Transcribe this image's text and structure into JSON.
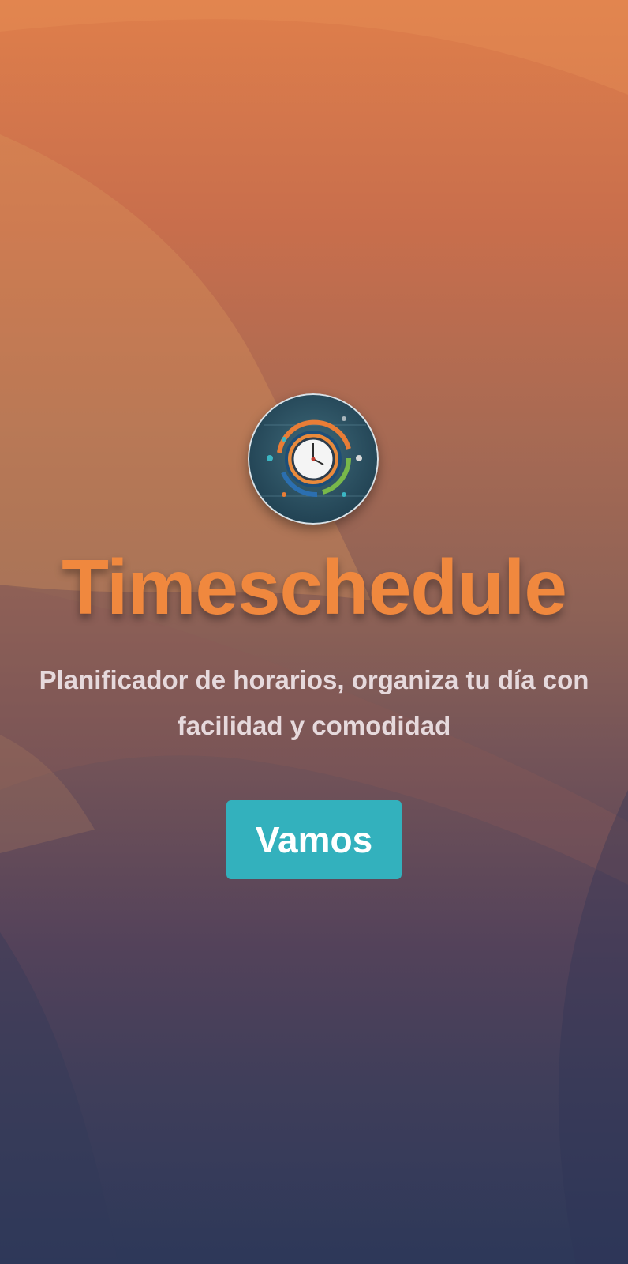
{
  "app": {
    "title": "Timeschedule",
    "subtitle": "Planificador de horarios, organiza tu día con facilidad y comodidad",
    "cta_label": "Vamos"
  },
  "logo": {
    "icon": "clock-icon"
  },
  "colors": {
    "accent_orange": "#f0883e",
    "button_teal": "#33b1bd",
    "subtitle_text": "#e6d9dc",
    "gradient_top": "#df7f4b",
    "gradient_bottom": "#2d3859"
  }
}
